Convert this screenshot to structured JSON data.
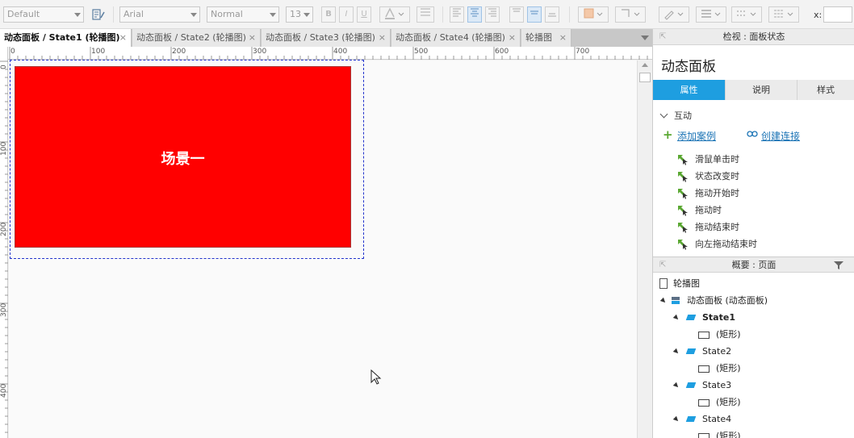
{
  "toolbar": {
    "style_select": "Default",
    "font_family": "Arial",
    "font_weight": "Normal",
    "font_size": "13",
    "bold": "B",
    "italic": "I",
    "underline": "U",
    "x_label": "x:"
  },
  "tabs": [
    {
      "label": "动态面板 / State1 (轮播图)",
      "active": true
    },
    {
      "label": "动态面板 / State2 (轮播图)",
      "active": false
    },
    {
      "label": "动态面板 / State3 (轮播图)",
      "active": false
    },
    {
      "label": "动态面板 / State4 (轮播图)",
      "active": false
    },
    {
      "label": "轮播图",
      "active": false
    }
  ],
  "tab_close": "×",
  "ruler": {
    "h_ticks": [
      "0",
      "100",
      "200",
      "300",
      "400",
      "500",
      "600",
      "700"
    ],
    "v_ticks": [
      "0",
      "100",
      "200",
      "300",
      "400"
    ]
  },
  "canvas": {
    "slide_label": "场景一",
    "slide_color": "#ff0000"
  },
  "inspector": {
    "header": "检视 : 面板状态",
    "title": "动态面板",
    "tabs": [
      "属性",
      "说明",
      "样式"
    ],
    "section": "互动",
    "add_case": "添加案例",
    "create_link": "创建连接",
    "events": [
      "滑鼠单击时",
      "状态改变时",
      "拖动开始时",
      "拖动时",
      "拖动结束时",
      "向左拖动结束时"
    ]
  },
  "outline": {
    "header": "概要 : 页面",
    "items": [
      {
        "label": "轮播图",
        "kind": "page"
      },
      {
        "label": "动态面板 (动态面板)",
        "kind": "panel"
      },
      {
        "label": "State1",
        "kind": "state",
        "bold": true
      },
      {
        "label": "(矩形)",
        "kind": "rect"
      },
      {
        "label": "State2",
        "kind": "state"
      },
      {
        "label": "(矩形)",
        "kind": "rect"
      },
      {
        "label": "State3",
        "kind": "state"
      },
      {
        "label": "(矩形)",
        "kind": "rect"
      },
      {
        "label": "State4",
        "kind": "state"
      },
      {
        "label": "(矩形)",
        "kind": "rect"
      }
    ]
  },
  "colors": {
    "accent": "#1e9ee0",
    "link": "#1a73b5",
    "add_green": "#5aa832"
  }
}
